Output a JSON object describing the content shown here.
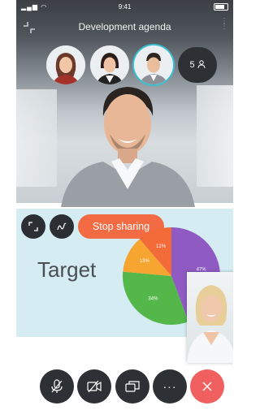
{
  "status": {
    "time": "9:41"
  },
  "header": {
    "title": "Development agenda"
  },
  "participants": {
    "count": "5"
  },
  "share": {
    "stop_label": "Stop sharing",
    "slide_title": "Target"
  },
  "chart_data": {
    "type": "pie",
    "title": "",
    "slices": [
      {
        "label": "47%",
        "value": 47,
        "color": "#8f5bc2"
      },
      {
        "label": "34%",
        "value": 34,
        "color": "#53b849"
      },
      {
        "label": "13%",
        "value": 13,
        "color": "#f7a531"
      },
      {
        "label": "12%",
        "value": 12,
        "color": "#f36b38"
      }
    ]
  },
  "colors": {
    "accent": "#37c0d0",
    "stop": "#f26b42",
    "end_call": "#f16060",
    "control": "#2d3034"
  },
  "controls": [
    "mute-icon",
    "video-off-icon",
    "share-screen-icon",
    "more-icon",
    "end-call-icon"
  ]
}
